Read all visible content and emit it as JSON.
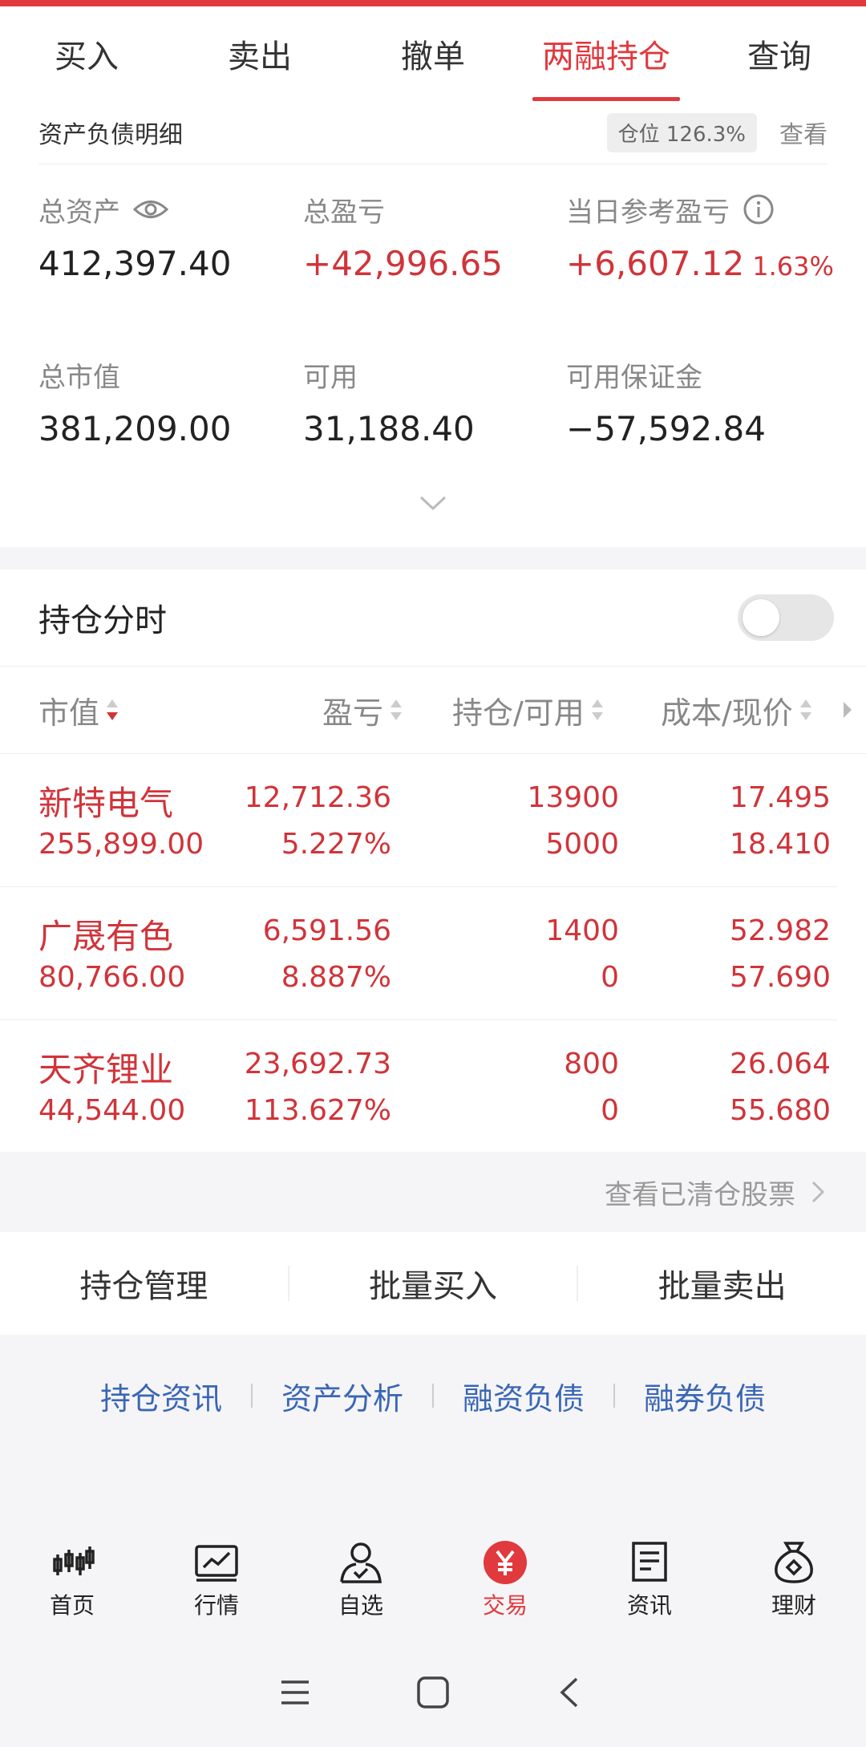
{
  "tabs": [
    {
      "label": "买入",
      "active": false
    },
    {
      "label": "卖出",
      "active": false
    },
    {
      "label": "撤单",
      "active": false
    },
    {
      "label": "两融持仓",
      "active": true
    },
    {
      "label": "查询",
      "active": false
    }
  ],
  "assets": {
    "title": "资产负债明细",
    "position_ratio": "仓位 126.3%",
    "view": "查看",
    "total_assets": {
      "label": "总资产",
      "value": "412,397.40"
    },
    "total_pnl": {
      "label": "总盈亏",
      "value": "+42,996.65"
    },
    "daily_pnl": {
      "label": "当日参考盈亏",
      "value": "+6,607.12",
      "pct": "1.63%"
    },
    "market_value": {
      "label": "总市值",
      "value": "381,209.00"
    },
    "available": {
      "label": "可用",
      "value": "31,188.40"
    },
    "available_margin": {
      "label": "可用保证金",
      "value": "−57,592.84"
    }
  },
  "positions": {
    "title": "持仓分时",
    "toggle_on": false,
    "columns": [
      "市值",
      "盈亏",
      "持仓/可用",
      "成本/现价"
    ],
    "rows": [
      {
        "name": "新特电气",
        "mv": "255,899.00",
        "pnl": "12,712.36",
        "pnl_pct": "5.227%",
        "hold": "13900",
        "avail": "5000",
        "cost": "17.495",
        "price": "18.410"
      },
      {
        "name": "广晟有色",
        "mv": "80,766.00",
        "pnl": "6,591.56",
        "pnl_pct": "8.887%",
        "hold": "1400",
        "avail": "0",
        "cost": "52.982",
        "price": "57.690"
      },
      {
        "name": "天齐锂业",
        "mv": "44,544.00",
        "pnl": "23,692.73",
        "pnl_pct": "113.627%",
        "hold": "800",
        "avail": "0",
        "cost": "26.064",
        "price": "55.680"
      }
    ]
  },
  "cleared_link": "查看已清仓股票",
  "actions": [
    "持仓管理",
    "批量买入",
    "批量卖出"
  ],
  "links": [
    "持仓资讯",
    "资产分析",
    "融资负债",
    "融券负债"
  ],
  "bottom_nav": [
    {
      "label": "首页",
      "icon": "candlestick-icon"
    },
    {
      "label": "行情",
      "icon": "chart-icon"
    },
    {
      "label": "自选",
      "icon": "person-check-icon"
    },
    {
      "label": "交易",
      "icon": "yen-icon",
      "active": true
    },
    {
      "label": "资讯",
      "icon": "document-icon"
    },
    {
      "label": "理财",
      "icon": "money-bag-icon"
    }
  ],
  "colors": {
    "accent": "#e0393e",
    "gain": "#d0343a",
    "link": "#3a66b5"
  }
}
